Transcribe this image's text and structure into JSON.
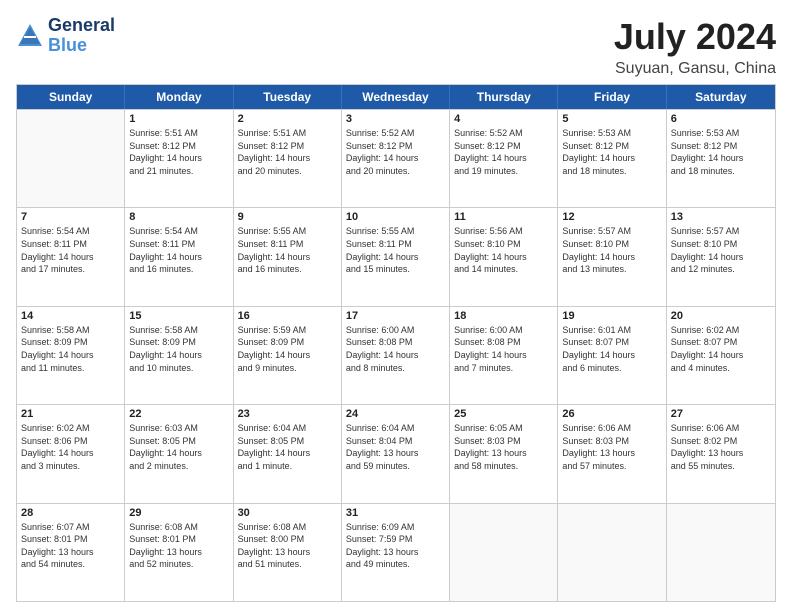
{
  "logo": {
    "line1": "General",
    "line2": "Blue"
  },
  "title": "July 2024",
  "subtitle": "Suyuan, Gansu, China",
  "headers": [
    "Sunday",
    "Monday",
    "Tuesday",
    "Wednesday",
    "Thursday",
    "Friday",
    "Saturday"
  ],
  "rows": [
    [
      {
        "day": "",
        "lines": []
      },
      {
        "day": "1",
        "lines": [
          "Sunrise: 5:51 AM",
          "Sunset: 8:12 PM",
          "Daylight: 14 hours",
          "and 21 minutes."
        ]
      },
      {
        "day": "2",
        "lines": [
          "Sunrise: 5:51 AM",
          "Sunset: 8:12 PM",
          "Daylight: 14 hours",
          "and 20 minutes."
        ]
      },
      {
        "day": "3",
        "lines": [
          "Sunrise: 5:52 AM",
          "Sunset: 8:12 PM",
          "Daylight: 14 hours",
          "and 20 minutes."
        ]
      },
      {
        "day": "4",
        "lines": [
          "Sunrise: 5:52 AM",
          "Sunset: 8:12 PM",
          "Daylight: 14 hours",
          "and 19 minutes."
        ]
      },
      {
        "day": "5",
        "lines": [
          "Sunrise: 5:53 AM",
          "Sunset: 8:12 PM",
          "Daylight: 14 hours",
          "and 18 minutes."
        ]
      },
      {
        "day": "6",
        "lines": [
          "Sunrise: 5:53 AM",
          "Sunset: 8:12 PM",
          "Daylight: 14 hours",
          "and 18 minutes."
        ]
      }
    ],
    [
      {
        "day": "7",
        "lines": [
          "Sunrise: 5:54 AM",
          "Sunset: 8:11 PM",
          "Daylight: 14 hours",
          "and 17 minutes."
        ]
      },
      {
        "day": "8",
        "lines": [
          "Sunrise: 5:54 AM",
          "Sunset: 8:11 PM",
          "Daylight: 14 hours",
          "and 16 minutes."
        ]
      },
      {
        "day": "9",
        "lines": [
          "Sunrise: 5:55 AM",
          "Sunset: 8:11 PM",
          "Daylight: 14 hours",
          "and 16 minutes."
        ]
      },
      {
        "day": "10",
        "lines": [
          "Sunrise: 5:55 AM",
          "Sunset: 8:11 PM",
          "Daylight: 14 hours",
          "and 15 minutes."
        ]
      },
      {
        "day": "11",
        "lines": [
          "Sunrise: 5:56 AM",
          "Sunset: 8:10 PM",
          "Daylight: 14 hours",
          "and 14 minutes."
        ]
      },
      {
        "day": "12",
        "lines": [
          "Sunrise: 5:57 AM",
          "Sunset: 8:10 PM",
          "Daylight: 14 hours",
          "and 13 minutes."
        ]
      },
      {
        "day": "13",
        "lines": [
          "Sunrise: 5:57 AM",
          "Sunset: 8:10 PM",
          "Daylight: 14 hours",
          "and 12 minutes."
        ]
      }
    ],
    [
      {
        "day": "14",
        "lines": [
          "Sunrise: 5:58 AM",
          "Sunset: 8:09 PM",
          "Daylight: 14 hours",
          "and 11 minutes."
        ]
      },
      {
        "day": "15",
        "lines": [
          "Sunrise: 5:58 AM",
          "Sunset: 8:09 PM",
          "Daylight: 14 hours",
          "and 10 minutes."
        ]
      },
      {
        "day": "16",
        "lines": [
          "Sunrise: 5:59 AM",
          "Sunset: 8:09 PM",
          "Daylight: 14 hours",
          "and 9 minutes."
        ]
      },
      {
        "day": "17",
        "lines": [
          "Sunrise: 6:00 AM",
          "Sunset: 8:08 PM",
          "Daylight: 14 hours",
          "and 8 minutes."
        ]
      },
      {
        "day": "18",
        "lines": [
          "Sunrise: 6:00 AM",
          "Sunset: 8:08 PM",
          "Daylight: 14 hours",
          "and 7 minutes."
        ]
      },
      {
        "day": "19",
        "lines": [
          "Sunrise: 6:01 AM",
          "Sunset: 8:07 PM",
          "Daylight: 14 hours",
          "and 6 minutes."
        ]
      },
      {
        "day": "20",
        "lines": [
          "Sunrise: 6:02 AM",
          "Sunset: 8:07 PM",
          "Daylight: 14 hours",
          "and 4 minutes."
        ]
      }
    ],
    [
      {
        "day": "21",
        "lines": [
          "Sunrise: 6:02 AM",
          "Sunset: 8:06 PM",
          "Daylight: 14 hours",
          "and 3 minutes."
        ]
      },
      {
        "day": "22",
        "lines": [
          "Sunrise: 6:03 AM",
          "Sunset: 8:05 PM",
          "Daylight: 14 hours",
          "and 2 minutes."
        ]
      },
      {
        "day": "23",
        "lines": [
          "Sunrise: 6:04 AM",
          "Sunset: 8:05 PM",
          "Daylight: 14 hours",
          "and 1 minute."
        ]
      },
      {
        "day": "24",
        "lines": [
          "Sunrise: 6:04 AM",
          "Sunset: 8:04 PM",
          "Daylight: 13 hours",
          "and 59 minutes."
        ]
      },
      {
        "day": "25",
        "lines": [
          "Sunrise: 6:05 AM",
          "Sunset: 8:03 PM",
          "Daylight: 13 hours",
          "and 58 minutes."
        ]
      },
      {
        "day": "26",
        "lines": [
          "Sunrise: 6:06 AM",
          "Sunset: 8:03 PM",
          "Daylight: 13 hours",
          "and 57 minutes."
        ]
      },
      {
        "day": "27",
        "lines": [
          "Sunrise: 6:06 AM",
          "Sunset: 8:02 PM",
          "Daylight: 13 hours",
          "and 55 minutes."
        ]
      }
    ],
    [
      {
        "day": "28",
        "lines": [
          "Sunrise: 6:07 AM",
          "Sunset: 8:01 PM",
          "Daylight: 13 hours",
          "and 54 minutes."
        ]
      },
      {
        "day": "29",
        "lines": [
          "Sunrise: 6:08 AM",
          "Sunset: 8:01 PM",
          "Daylight: 13 hours",
          "and 52 minutes."
        ]
      },
      {
        "day": "30",
        "lines": [
          "Sunrise: 6:08 AM",
          "Sunset: 8:00 PM",
          "Daylight: 13 hours",
          "and 51 minutes."
        ]
      },
      {
        "day": "31",
        "lines": [
          "Sunrise: 6:09 AM",
          "Sunset: 7:59 PM",
          "Daylight: 13 hours",
          "and 49 minutes."
        ]
      },
      {
        "day": "",
        "lines": []
      },
      {
        "day": "",
        "lines": []
      },
      {
        "day": "",
        "lines": []
      }
    ]
  ]
}
